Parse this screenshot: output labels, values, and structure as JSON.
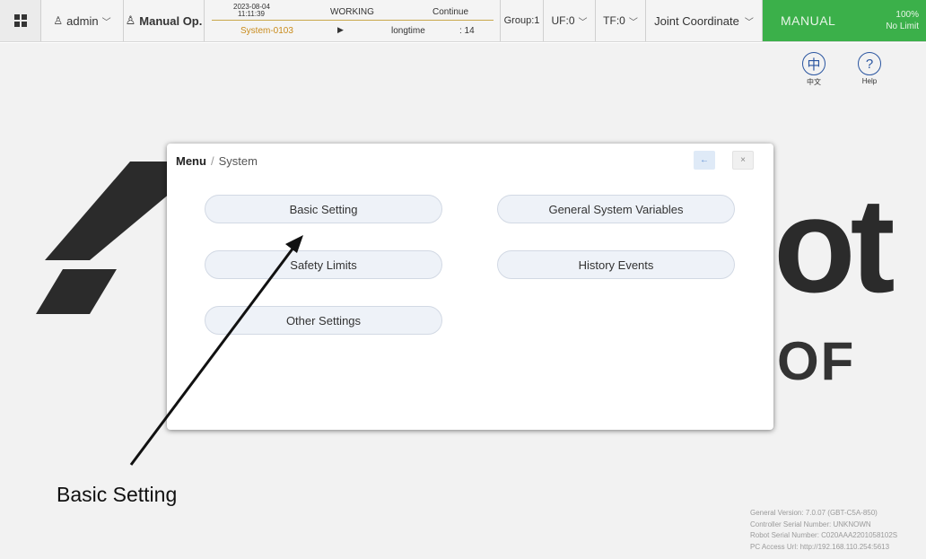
{
  "topbar": {
    "user": "admin",
    "mode": "Manual Op.",
    "date": "2023-08-04",
    "time": "11:11:39",
    "state": "WORKING",
    "continue_label": "Continue",
    "program": "System-0103",
    "play_symbol": "▶",
    "run_mode": "longtime",
    "line": ": 14",
    "group": "Group:1",
    "uf": "UF:0",
    "tf": "TF:0",
    "coordinate": "Joint Coordinate",
    "manual": "MANUAL",
    "speed": "100%",
    "limit": "No Limit"
  },
  "background": {
    "logo_right": "ot",
    "logo_sub": "OF",
    "lang_symbol": "中",
    "lang_label": "中文",
    "help_symbol": "?",
    "help_label": "Help"
  },
  "info": {
    "general_version": "General Version:  7.0.07 (GBT-C5A-850)",
    "controller_serial": "Controller Serial Number:  UNKNOWN",
    "robot_serial": "Robot Serial Number:  C020AAA2201058102S",
    "pc_access": "PC Access Url:  http://192.168.110.254:5613"
  },
  "modal": {
    "breadcrumb_root": "Menu",
    "breadcrumb_sep": "/",
    "breadcrumb_current": "System",
    "back_symbol": "←",
    "close_symbol": "×",
    "items": [
      {
        "label": "Basic Setting"
      },
      {
        "label": "General System Variables"
      },
      {
        "label": "Safety Limits"
      },
      {
        "label": "History Events"
      },
      {
        "label": "Other Settings"
      }
    ]
  },
  "annotation": {
    "label": "Basic Setting",
    "color": "#111111"
  }
}
